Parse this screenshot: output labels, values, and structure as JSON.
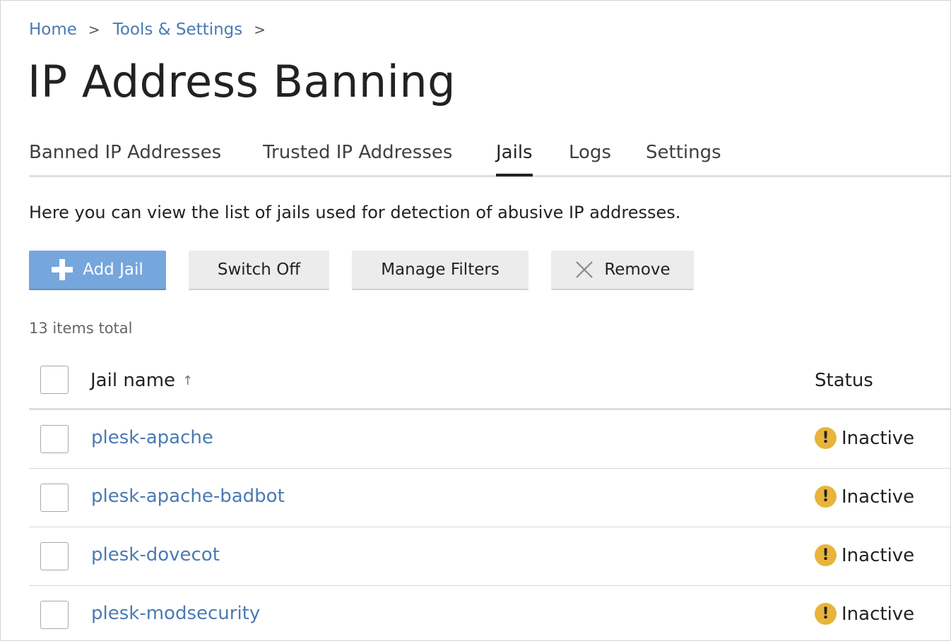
{
  "breadcrumb": {
    "items": [
      {
        "label": "Home"
      },
      {
        "label": "Tools & Settings"
      }
    ],
    "separator": ">"
  },
  "page_title": "IP Address Banning",
  "tabs": [
    {
      "label": "Banned IP Addresses",
      "active": false
    },
    {
      "label": "Trusted IP Addresses",
      "active": false
    },
    {
      "label": "Jails",
      "active": true
    },
    {
      "label": "Logs",
      "active": false
    },
    {
      "label": "Settings",
      "active": false
    }
  ],
  "description": "Here you can view the list of jails used for detection of abusive IP addresses.",
  "toolbar": {
    "add_jail_label": "Add Jail",
    "switch_off_label": "Switch Off",
    "manage_filters_label": "Manage Filters",
    "remove_label": "Remove",
    "accent_color": "#75a6dc"
  },
  "items_total": "13 items total",
  "table": {
    "columns": {
      "name": "Jail name",
      "sort_indicator": "↑",
      "status": "Status"
    },
    "rows": [
      {
        "name": "plesk-apache",
        "status": "Inactive",
        "status_icon": "warning-icon"
      },
      {
        "name": "plesk-apache-badbot",
        "status": "Inactive",
        "status_icon": "warning-icon"
      },
      {
        "name": "plesk-dovecot",
        "status": "Inactive",
        "status_icon": "warning-icon"
      },
      {
        "name": "plesk-modsecurity",
        "status": "Inactive",
        "status_icon": "warning-icon"
      }
    ],
    "warning_color": "#e8b43a",
    "link_color": "#4a7ab3"
  }
}
